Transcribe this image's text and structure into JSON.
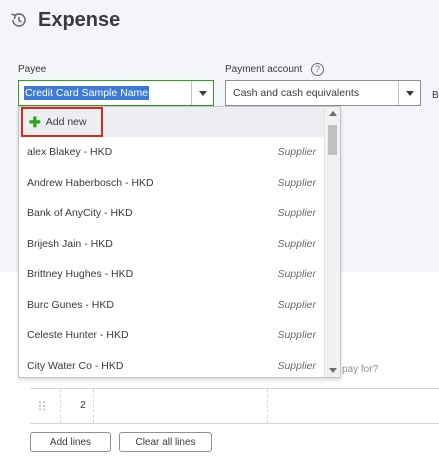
{
  "header": {
    "title": "Expense",
    "icon": "history-icon"
  },
  "payee": {
    "label": "Payee",
    "value": "Credit Card Sample Name"
  },
  "payment_account": {
    "label": "Payment account",
    "value": "Cash and cash equivalents",
    "help_glyph": "?"
  },
  "partial_label": "Ba",
  "dropdown": {
    "add_new_label": "Add new",
    "items": [
      {
        "name": "alex Blakey - HKD",
        "type": "Supplier"
      },
      {
        "name": "Andrew Haberbosch - HKD",
        "type": "Supplier"
      },
      {
        "name": "Bank of AnyCity - HKD",
        "type": "Supplier"
      },
      {
        "name": "Brijesh Jain - HKD",
        "type": "Supplier"
      },
      {
        "name": "Brittney Hughes - HKD",
        "type": "Supplier"
      },
      {
        "name": "Burc Gunes - HKD",
        "type": "Supplier"
      },
      {
        "name": "Celeste Hunter - HKD",
        "type": "Supplier"
      },
      {
        "name": "City Water Co - HKD",
        "type": "Supplier"
      }
    ]
  },
  "background_text": "pay for?",
  "line_items": {
    "row_number": "2"
  },
  "buttons": {
    "add_lines": "Add lines",
    "clear_all_lines": "Clear all lines"
  },
  "colors": {
    "accent_green": "#2ca01c",
    "highlight_red": "#d52b1e",
    "selection_blue": "#3d7bd9"
  }
}
